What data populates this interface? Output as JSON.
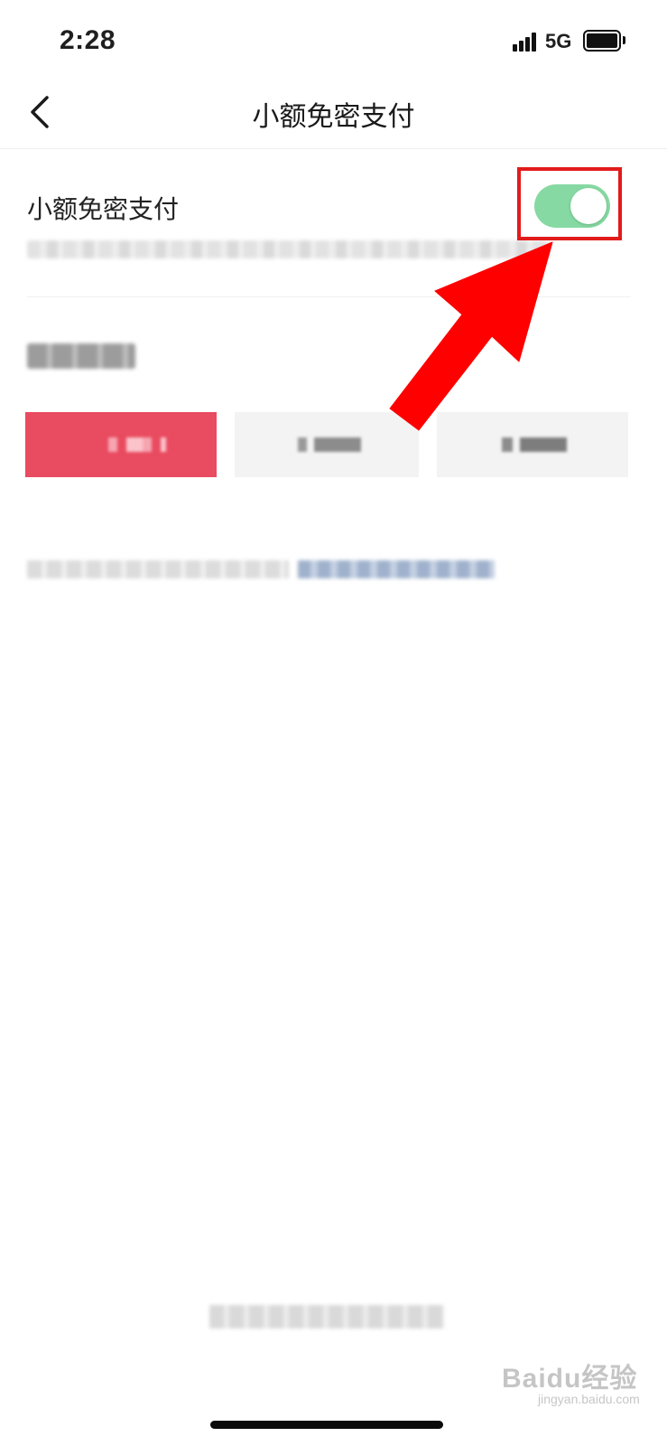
{
  "status_bar": {
    "time": "2:28",
    "network": "5G"
  },
  "nav": {
    "title": "小额免密支付"
  },
  "setting": {
    "label": "小额免密支付",
    "enabled": true
  },
  "colors": {
    "toggle_on": "#86d9a2",
    "selected_option": "#e94b60",
    "annotation": "#e21b1b"
  },
  "watermark": {
    "text": "Baidu经验",
    "sub": "jingyan.baidu.com"
  },
  "icons": [
    "back-chevron-icon",
    "signal-icon",
    "battery-icon"
  ]
}
